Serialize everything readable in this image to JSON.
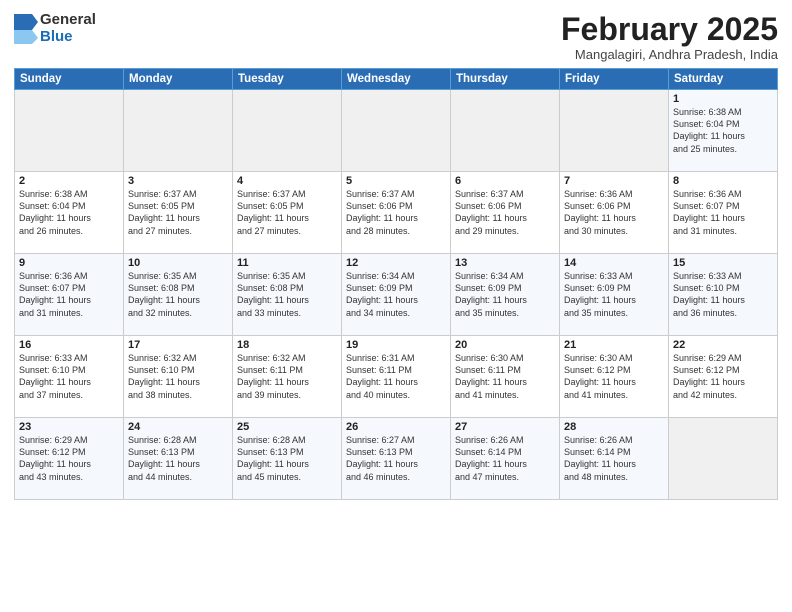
{
  "logo": {
    "general": "General",
    "blue": "Blue"
  },
  "title": "February 2025",
  "location": "Mangalagiri, Andhra Pradesh, India",
  "weekdays": [
    "Sunday",
    "Monday",
    "Tuesday",
    "Wednesday",
    "Thursday",
    "Friday",
    "Saturday"
  ],
  "weeks": [
    [
      {
        "day": "",
        "info": ""
      },
      {
        "day": "",
        "info": ""
      },
      {
        "day": "",
        "info": ""
      },
      {
        "day": "",
        "info": ""
      },
      {
        "day": "",
        "info": ""
      },
      {
        "day": "",
        "info": ""
      },
      {
        "day": "1",
        "info": "Sunrise: 6:38 AM\nSunset: 6:04 PM\nDaylight: 11 hours\nand 25 minutes."
      }
    ],
    [
      {
        "day": "2",
        "info": "Sunrise: 6:38 AM\nSunset: 6:04 PM\nDaylight: 11 hours\nand 26 minutes."
      },
      {
        "day": "3",
        "info": "Sunrise: 6:37 AM\nSunset: 6:05 PM\nDaylight: 11 hours\nand 27 minutes."
      },
      {
        "day": "4",
        "info": "Sunrise: 6:37 AM\nSunset: 6:05 PM\nDaylight: 11 hours\nand 27 minutes."
      },
      {
        "day": "5",
        "info": "Sunrise: 6:37 AM\nSunset: 6:06 PM\nDaylight: 11 hours\nand 28 minutes."
      },
      {
        "day": "6",
        "info": "Sunrise: 6:37 AM\nSunset: 6:06 PM\nDaylight: 11 hours\nand 29 minutes."
      },
      {
        "day": "7",
        "info": "Sunrise: 6:36 AM\nSunset: 6:06 PM\nDaylight: 11 hours\nand 30 minutes."
      },
      {
        "day": "8",
        "info": "Sunrise: 6:36 AM\nSunset: 6:07 PM\nDaylight: 11 hours\nand 31 minutes."
      }
    ],
    [
      {
        "day": "9",
        "info": "Sunrise: 6:36 AM\nSunset: 6:07 PM\nDaylight: 11 hours\nand 31 minutes."
      },
      {
        "day": "10",
        "info": "Sunrise: 6:35 AM\nSunset: 6:08 PM\nDaylight: 11 hours\nand 32 minutes."
      },
      {
        "day": "11",
        "info": "Sunrise: 6:35 AM\nSunset: 6:08 PM\nDaylight: 11 hours\nand 33 minutes."
      },
      {
        "day": "12",
        "info": "Sunrise: 6:34 AM\nSunset: 6:09 PM\nDaylight: 11 hours\nand 34 minutes."
      },
      {
        "day": "13",
        "info": "Sunrise: 6:34 AM\nSunset: 6:09 PM\nDaylight: 11 hours\nand 35 minutes."
      },
      {
        "day": "14",
        "info": "Sunrise: 6:33 AM\nSunset: 6:09 PM\nDaylight: 11 hours\nand 35 minutes."
      },
      {
        "day": "15",
        "info": "Sunrise: 6:33 AM\nSunset: 6:10 PM\nDaylight: 11 hours\nand 36 minutes."
      }
    ],
    [
      {
        "day": "16",
        "info": "Sunrise: 6:33 AM\nSunset: 6:10 PM\nDaylight: 11 hours\nand 37 minutes."
      },
      {
        "day": "17",
        "info": "Sunrise: 6:32 AM\nSunset: 6:10 PM\nDaylight: 11 hours\nand 38 minutes."
      },
      {
        "day": "18",
        "info": "Sunrise: 6:32 AM\nSunset: 6:11 PM\nDaylight: 11 hours\nand 39 minutes."
      },
      {
        "day": "19",
        "info": "Sunrise: 6:31 AM\nSunset: 6:11 PM\nDaylight: 11 hours\nand 40 minutes."
      },
      {
        "day": "20",
        "info": "Sunrise: 6:30 AM\nSunset: 6:11 PM\nDaylight: 11 hours\nand 41 minutes."
      },
      {
        "day": "21",
        "info": "Sunrise: 6:30 AM\nSunset: 6:12 PM\nDaylight: 11 hours\nand 41 minutes."
      },
      {
        "day": "22",
        "info": "Sunrise: 6:29 AM\nSunset: 6:12 PM\nDaylight: 11 hours\nand 42 minutes."
      }
    ],
    [
      {
        "day": "23",
        "info": "Sunrise: 6:29 AM\nSunset: 6:12 PM\nDaylight: 11 hours\nand 43 minutes."
      },
      {
        "day": "24",
        "info": "Sunrise: 6:28 AM\nSunset: 6:13 PM\nDaylight: 11 hours\nand 44 minutes."
      },
      {
        "day": "25",
        "info": "Sunrise: 6:28 AM\nSunset: 6:13 PM\nDaylight: 11 hours\nand 45 minutes."
      },
      {
        "day": "26",
        "info": "Sunrise: 6:27 AM\nSunset: 6:13 PM\nDaylight: 11 hours\nand 46 minutes."
      },
      {
        "day": "27",
        "info": "Sunrise: 6:26 AM\nSunset: 6:14 PM\nDaylight: 11 hours\nand 47 minutes."
      },
      {
        "day": "28",
        "info": "Sunrise: 6:26 AM\nSunset: 6:14 PM\nDaylight: 11 hours\nand 48 minutes."
      },
      {
        "day": "",
        "info": ""
      }
    ]
  ]
}
